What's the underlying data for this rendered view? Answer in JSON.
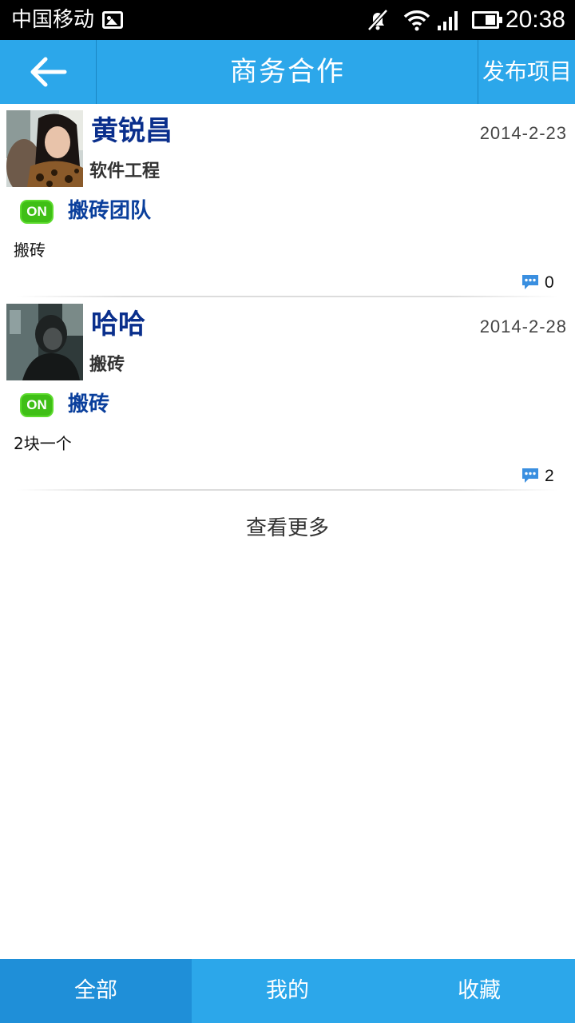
{
  "status_bar": {
    "carrier": "中国移动",
    "time": "20:38"
  },
  "header": {
    "title": "商务合作",
    "publish_label": "发布项目",
    "back_icon": "arrow-left-icon"
  },
  "posts": [
    {
      "author": "黄锐昌",
      "role": "软件工程",
      "date": "2014-2-23",
      "badge": "ON",
      "project": "搬砖团队",
      "content": "搬砖",
      "comments": "0"
    },
    {
      "author": "哈哈",
      "role": "搬砖",
      "date": "2014-2-28",
      "badge": "ON",
      "project": "搬砖",
      "content": "2块一个",
      "comments": "2"
    }
  ],
  "load_more": "查看更多",
  "tabs": [
    {
      "label": "全部",
      "active": true
    },
    {
      "label": "我的",
      "active": false
    },
    {
      "label": "收藏",
      "active": false
    }
  ],
  "colors": {
    "accent": "#2ca7ea",
    "active_tab": "#1f8fd8",
    "name_blue": "#0a2f8c",
    "badge_green": "#3fbf16"
  }
}
